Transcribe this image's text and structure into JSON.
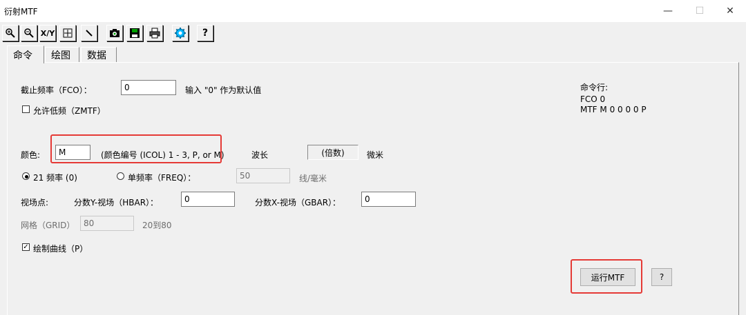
{
  "window": {
    "title": "衍射MTF",
    "controls": {
      "minimize": "—",
      "maximize": "☐",
      "close": "✕"
    }
  },
  "toolbar": {
    "buttons": [
      "zoom-in-icon",
      "zoom-out-icon",
      "xy-icon",
      "fit-icon",
      "pen-icon",
      "camera-icon",
      "save-icon",
      "print-icon",
      "settings-icon",
      "help-icon"
    ],
    "xy_label": "X/Y",
    "help_label": "?"
  },
  "tabs": [
    {
      "label": "命令",
      "active": true
    },
    {
      "label": "绘图",
      "active": false
    },
    {
      "label": "数据",
      "active": false
    }
  ],
  "form": {
    "fco_label": "截止频率（FCO）：",
    "fco_value": "0",
    "fco_hint": "输入 \"0\" 作为默认值",
    "zmtf_label": "允许低频（ZMTF）",
    "zmtf_checked": false,
    "color_label": "颜色:",
    "color_value": "M",
    "color_hint": "(颜色编号 (ICOL) 1 - 3, P, or M)",
    "wavelength_label": "波长",
    "wavelength_value": "(倍数)",
    "wavelength_unit": "微米",
    "freq21_label": "21 频率 (0)",
    "freq21_selected": true,
    "single_freq_label": "单频率（FREQ）：",
    "single_freq_selected": false,
    "freq_value": "50",
    "freq_unit": "线/毫米",
    "field_label": "视场点:",
    "hbar_label": "分数Y-视场（HBAR）：",
    "hbar_value": "0",
    "gbar_label": "分数X-视场（GBAR）：",
    "gbar_value": "0",
    "grid_label": "网格（GRID）",
    "grid_value": "80",
    "grid_range": "20到80",
    "plot_label": "绘制曲线（P）",
    "plot_checked": true,
    "run_button": "运行MTF",
    "help_button": "?"
  },
  "command_line": {
    "label": "命令行:",
    "lines": [
      "FCO 0",
      "MTF M 0 0 0 0 P"
    ]
  },
  "colors": {
    "highlight": "#e53935",
    "background": "#f0f0f0",
    "accent": "#0078d7"
  }
}
